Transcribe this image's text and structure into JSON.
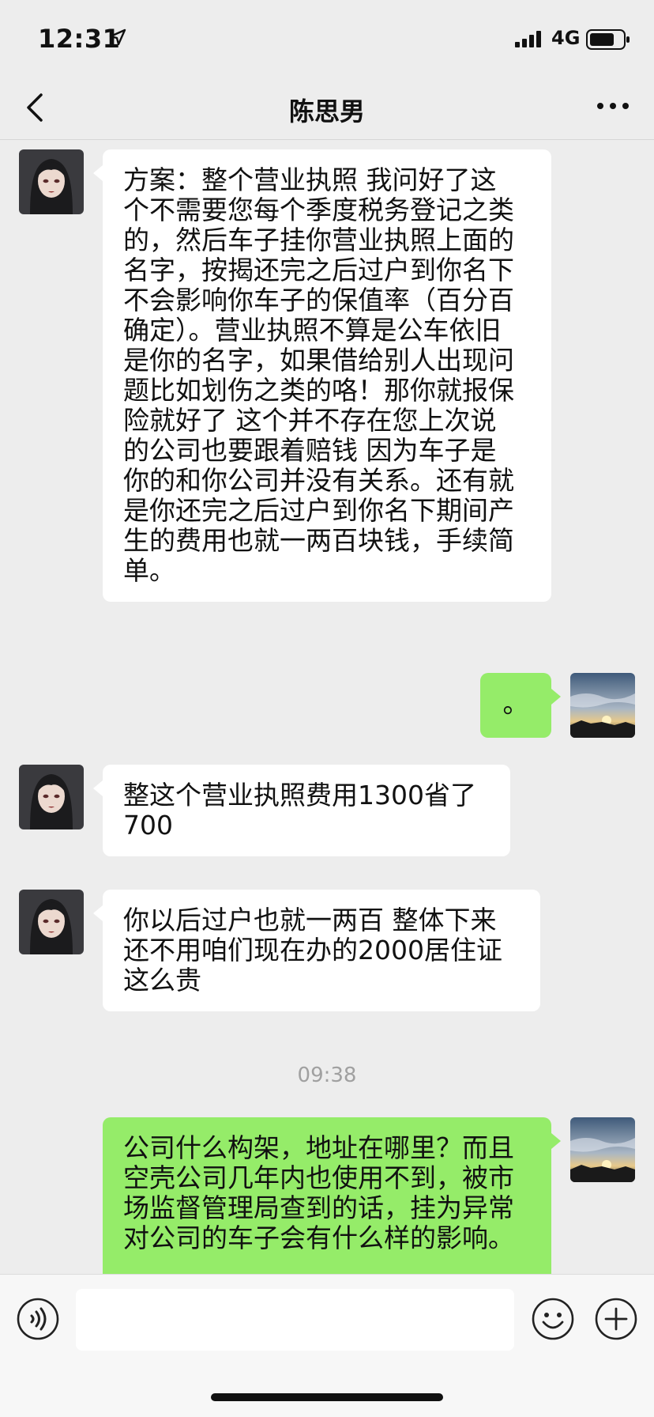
{
  "status_bar": {
    "time": "12:31",
    "network": "4G",
    "icons": [
      "location-arrow-icon",
      "signal-bars-icon",
      "battery-icon"
    ]
  },
  "nav": {
    "title": "陈思男",
    "icons": [
      "back-chevron-icon",
      "more-dots-icon"
    ]
  },
  "messages": [
    {
      "side": "left",
      "lines": [
        "方案：整个营业执照 我问好了这",
        "个不需要您每个季度税务登记之类",
        "的，然后车子挂你营业执照上面的",
        "名字，按揭还完之后过户到你名下",
        "不会影响你车子的保值率（百分百",
        "确定）。营业执照不算是公车依旧",
        "是你的名字，如果借给别人出现问",
        "题比如划伤之类的咯！那你就报保",
        "险就好了 这个并不存在您上次说",
        "的公司也要跟着赔钱 因为车子是",
        "你的和你公司并没有关系。还有就",
        "是你还完之后过户到你名下期间产",
        "生的费用也就一两百块钱，手续简",
        "单。"
      ]
    },
    {
      "side": "right",
      "lines": [
        "。"
      ]
    },
    {
      "side": "left",
      "lines": [
        "整这个营业执照费用1300省了",
        "700"
      ]
    },
    {
      "side": "left",
      "lines": [
        "你以后过户也就一两百 整体下来",
        "还不用咱们现在办的2000居住证",
        "这么贵"
      ]
    },
    {
      "side": "right",
      "lines": [
        "公司什么构架，地址在哪里？而且",
        "空壳公司几年内也使用不到，被市",
        "场监督管理局查到的话，挂为异常",
        "对公司的车子会有什么样的影响。"
      ]
    }
  ],
  "timestamp": "09:38",
  "input_bar": {
    "text_value": "",
    "icons": [
      "voice-icon",
      "emoji-icon",
      "plus-icon"
    ]
  },
  "colors": {
    "background": "#ededed",
    "bubble_left": "#ffffff",
    "bubble_right": "#95ec69",
    "timestamp": "#a0a0a0"
  }
}
